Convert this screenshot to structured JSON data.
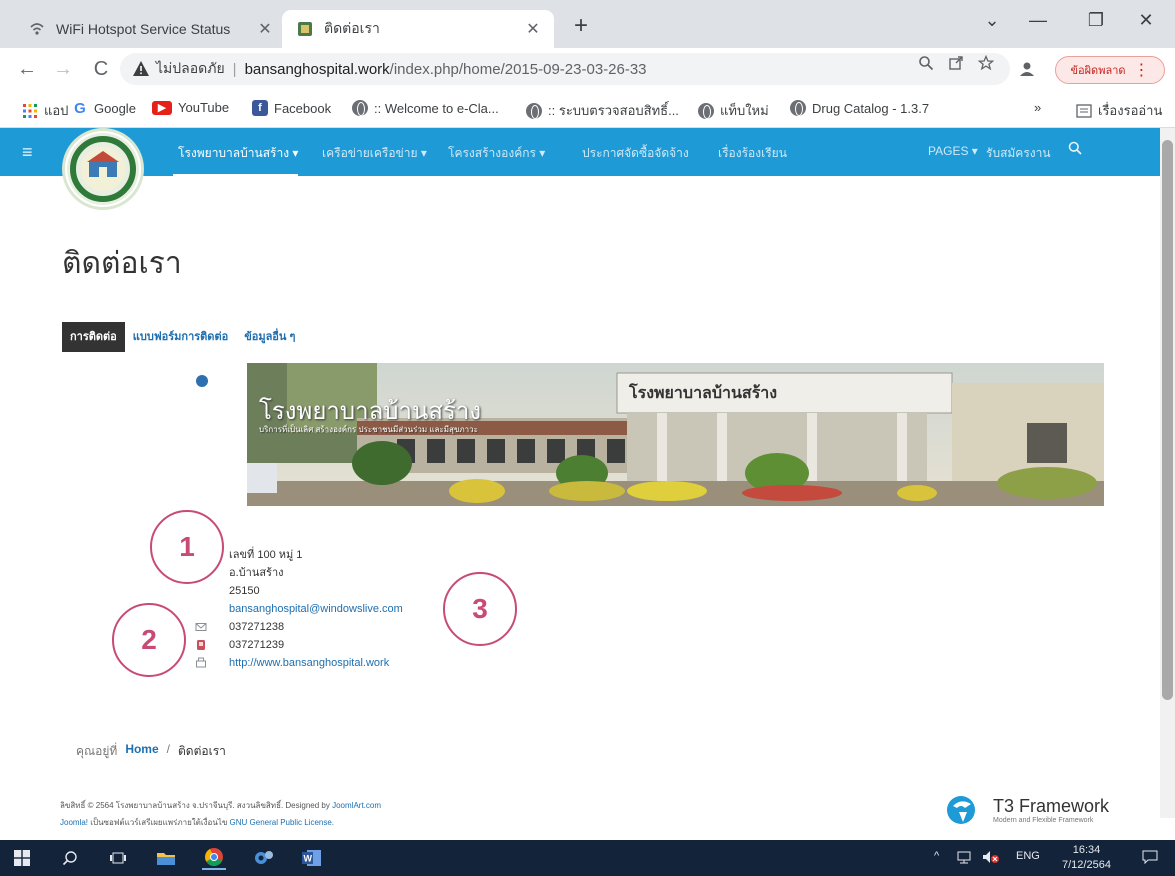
{
  "browser": {
    "tabs": [
      {
        "title": "WiFi Hotspot Service Status",
        "close": "✕"
      },
      {
        "title": "ติดต่อเรา",
        "close": "✕"
      }
    ],
    "new_tab": "+",
    "window": {
      "dropdown": "⌄",
      "minimize": "—",
      "restore": "❐",
      "close": "✕"
    },
    "nav": {
      "back": "←",
      "forward": "→",
      "reload": "C"
    },
    "address": {
      "not_secure": "ไม่ปลอดภัย",
      "separator": "|",
      "host": "bansanghospital.work",
      "path": "/index.php/home/2015-09-23-03-26-33"
    },
    "error_pill": {
      "label": "ข้อผิดพลาด",
      "dots": "⋮"
    },
    "bookmarks": [
      {
        "label": "แอป",
        "icon": "apps-grid-icon"
      },
      {
        "label": "Google",
        "icon": "google-icon"
      },
      {
        "label": "YouTube",
        "icon": "youtube-icon"
      },
      {
        "label": "Facebook",
        "icon": "facebook-icon"
      },
      {
        "label": ":: Welcome to e-Cla...",
        "icon": "globe-icon"
      },
      {
        "label": ":: ระบบตรวจสอบสิทธิ์...",
        "icon": "globe-icon"
      },
      {
        "label": "แท็บใหม่",
        "icon": "globe-icon"
      },
      {
        "label": "Drug Catalog - 1.3.7",
        "icon": "globe-icon"
      }
    ],
    "more_bookmarks": "»",
    "reading_list": "เรื่องรออ่าน"
  },
  "site": {
    "nav": [
      "โรงพยาบาลบ้านสร้าง ▾",
      "เครือข่ายเครือข่าย ▾",
      "โครงสร้างองค์กร ▾",
      "ประกาศจัดซื้อจัดจ้าง",
      "เรื่องร้องเรียน",
      "PAGES ▾",
      "รับสมัครงาน"
    ],
    "hamburger": "≡",
    "search": "🔍",
    "page_title": "ติดต่อเรา",
    "sub_tabs": [
      "การติดต่อ",
      "แบบฟอร์มการติดต่อ",
      "ข้อมูลอื่น ๆ"
    ],
    "banner": {
      "title": "โรงพยาบาลบ้านสร้าง",
      "subtitle": "บริการที่เป็นเลิศ สร้างองค์กร ประชาชนมีส่วนร่วม และมีสุขภาวะ",
      "sign": "โรงพยาบาลบ้านสร้าง"
    },
    "contact": {
      "address1": "เลขที่ 100 หมู่ 1",
      "address2": "อ.บ้านสร้าง",
      "postal": "25150",
      "email": "bansanghospital@windowslive.com",
      "phone": "037271238",
      "fax": "037271239",
      "website": "http://www.bansanghospital.work"
    },
    "annotations": [
      "1",
      "2",
      "3"
    ],
    "breadcrumb": {
      "prefix": "คุณอยู่ที่",
      "home": "Home",
      "sep": "/",
      "current": "ติดต่อเรา"
    },
    "footer": {
      "line1_text": "ลิขสิทธิ์ © 2564 โรงพยาบาลบ้านสร้าง จ.ปราจีนบุรี. สงวนลิขสิทธิ์. Designed by",
      "line1_link": "JoomlArt.com",
      "line2_prefix": "Joomla!",
      "line2_text": "เป็นซอฟต์แวร์เสรีเผยแพร่ภายใต้เงื่อนไข",
      "line2_link": "GNU General Public License."
    },
    "t3": {
      "name": "T3 Framework",
      "tagline": "Modern and Flexible Framework"
    }
  },
  "taskbar": {
    "tray_up": "^",
    "language": "ENG",
    "time": "16:34",
    "date": "7/12/2564"
  },
  "colors": {
    "nav_blue": "#1e9ad6",
    "annotation": "#c84a76",
    "taskbar": "#13233a"
  }
}
